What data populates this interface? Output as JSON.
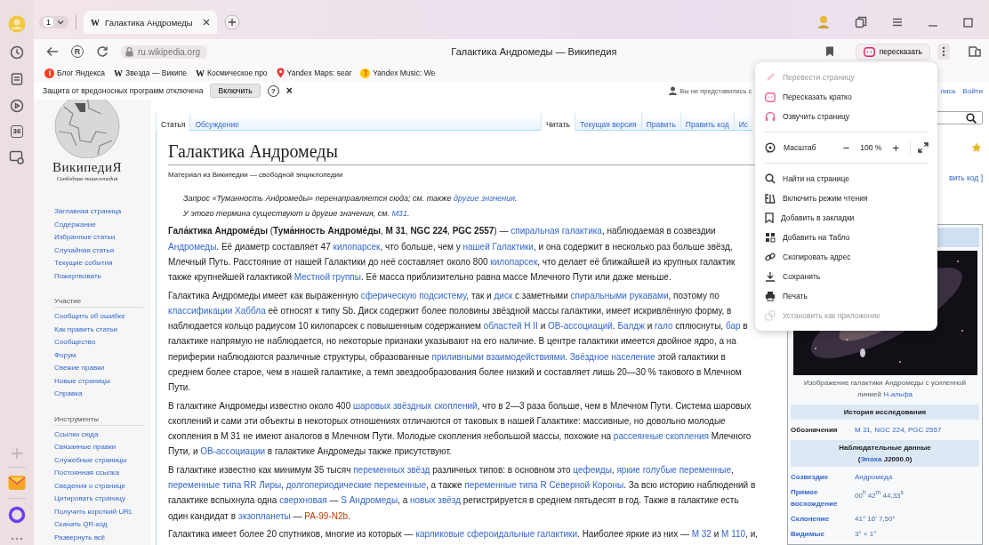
{
  "browser_sidebar": {
    "badge": "36"
  },
  "tab_bar": {
    "tab_count": "1",
    "tabs": [
      {
        "favicon": "W",
        "title": "Галактика Андромеды",
        "selected": true
      }
    ]
  },
  "address_bar": {
    "home_glyph": "R",
    "url": "ru.wikipedia.org",
    "page_title": "Галактика Андромеды — Википедия",
    "summarize_button": "пересказать"
  },
  "bookmarks": [
    {
      "kind": "yandex",
      "label": "Блог Яндекса"
    },
    {
      "kind": "wiki",
      "favicon": "W",
      "label": "Звезда — Википе"
    },
    {
      "kind": "wiki",
      "favicon": "W",
      "label": "Космическое про"
    },
    {
      "kind": "maps",
      "label": "Yandex Maps: sear"
    },
    {
      "kind": "music",
      "label": "Yandex Music: We"
    }
  ],
  "infobar": {
    "message": "Защита от вредоносных программ отключена",
    "button": "Включить",
    "help": "?",
    "close": "×"
  },
  "user_bar": {
    "notice": "Вы не представились с",
    "link": "лись",
    "login": "Войти"
  },
  "wiki_sidebar": {
    "logo_title": "ВикипедиЯ",
    "logo_subtitle": "Свободная энциклопедия",
    "groups": [
      {
        "links": [
          "Заглавная страница",
          "Содержание",
          "Избранные статьи",
          "Случайная статья",
          "Текущие события",
          "Пожертвовать"
        ]
      },
      {
        "heading": "Участие",
        "links": [
          "Сообщить об ошибке",
          "Как править статьи",
          "Сообщество",
          "Форум",
          "Свежие правки",
          "Новые страницы",
          "Справка"
        ]
      },
      {
        "heading": "Инструменты",
        "links": [
          "Ссылки сюда",
          "Связанные правки",
          "Служебные страницы",
          "Постоянная ссылка",
          "Сведения о странице",
          "Цитировать страницу",
          "Получить короткий URL",
          "Скачать QR-код",
          "Развернуть всё"
        ]
      }
    ]
  },
  "page_tabs": {
    "left": [
      {
        "label": "Статья",
        "selected": true
      },
      {
        "label": "Обсуждение",
        "selected": false
      }
    ],
    "right": [
      {
        "label": "Читать",
        "selected": true
      },
      {
        "label": "Текущая версия",
        "selected": false
      },
      {
        "label": "Править",
        "selected": false
      },
      {
        "label": "Править код",
        "selected": false
      },
      {
        "label": "Ис",
        "selected": false
      }
    ]
  },
  "article": {
    "title": "Галактика Андромеды",
    "subtitle": "Материал из Википедии — свободной энциклопедии",
    "hatnotes": [
      [
        {
          "kind": "text",
          "text": "Запрос «Туманность Андромеды» перенаправляется сюда; см. также "
        },
        {
          "kind": "link",
          "text": "другие значения"
        },
        {
          "kind": "text",
          "text": "."
        }
      ],
      [
        {
          "kind": "text",
          "text": "У этого термина существуют и другие значения, см. "
        },
        {
          "kind": "link",
          "text": "M31"
        },
        {
          "kind": "text",
          "text": "."
        }
      ]
    ],
    "paragraphs": [
      {
        "lines": [
          [
            {
              "kind": "text",
              "text": "**Гала́ктика Андроме́ды** (**Тума́нность Андроме́ды**, **M 31**, **NGC 224**, **PGC 2557**) — "
            },
            {
              "kind": "link",
              "text": "спиральная галактика"
            },
            {
              "kind": "text",
              "text": ", наблюдаемая в созвездии"
            }
          ],
          [
            {
              "kind": "link",
              "text": "Андромеды"
            },
            {
              "kind": "text",
              "text": ". Её диаметр составляет 47 "
            },
            {
              "kind": "link",
              "text": "килопарсек"
            },
            {
              "kind": "text",
              "text": ", что больше, чем у "
            },
            {
              "kind": "link",
              "text": "нашей Галактики"
            },
            {
              "kind": "text",
              "text": ", и она содержит в несколько раз больше звёзд,"
            }
          ],
          [
            {
              "kind": "text",
              "text": "Млечный Путь. Расстояние от нашей Галактики до неё составляет около 800 "
            },
            {
              "kind": "link",
              "text": "килопарсек"
            },
            {
              "kind": "text",
              "text": ", что делает её ближайшей из крупных галактик"
            }
          ],
          [
            {
              "kind": "text",
              "text": "также крупнейшей галактикой "
            },
            {
              "kind": "link",
              "text": "Местной группы"
            },
            {
              "kind": "text",
              "text": ". Её масса приблизительно равна массе Млечного Пути или даже меньше."
            }
          ]
        ]
      },
      {
        "lines": [
          [
            {
              "kind": "text",
              "text": "Галактика Андромеды имеет как выраженную "
            },
            {
              "kind": "link",
              "text": "сферическую подсистему"
            },
            {
              "kind": "text",
              "text": ", так и "
            },
            {
              "kind": "link",
              "text": "диск"
            },
            {
              "kind": "text",
              "text": " с заметными "
            },
            {
              "kind": "link",
              "text": "спиральными рукавами"
            },
            {
              "kind": "text",
              "text": ", поэтому по"
            }
          ],
          [
            {
              "kind": "link",
              "text": "классификации Хаббла"
            },
            {
              "kind": "text",
              "text": " её относят к типу Sb. Диск содержит более половины звёздной массы галактики, имеет искривлённую форму, в"
            }
          ],
          [
            {
              "kind": "text",
              "text": "наблюдается кольцо радиусом 10 килопарсек с повышенным содержанием "
            },
            {
              "kind": "link",
              "text": "областей H II"
            },
            {
              "kind": "text",
              "text": " и "
            },
            {
              "kind": "link",
              "text": "OB-ассоциаций"
            },
            {
              "kind": "text",
              "text": ". "
            },
            {
              "kind": "link",
              "text": "Балдж"
            },
            {
              "kind": "text",
              "text": " и "
            },
            {
              "kind": "link",
              "text": "гало"
            },
            {
              "kind": "text",
              "text": " сплюснуты, "
            },
            {
              "kind": "link",
              "text": "бар"
            },
            {
              "kind": "text",
              "text": " в"
            }
          ],
          [
            {
              "kind": "text",
              "text": "галактике напрямую не наблюдается, но некоторые признаки указывают на его наличие. В центре галактики имеется двойное ядро, а на"
            }
          ],
          [
            {
              "kind": "text",
              "text": "периферии наблюдаются различные структуры, образованные "
            },
            {
              "kind": "link",
              "text": "приливными взаимодействиями"
            },
            {
              "kind": "text",
              "text": ". "
            },
            {
              "kind": "link",
              "text": "Звёздное население"
            },
            {
              "kind": "text",
              "text": " этой галактики в"
            }
          ],
          [
            {
              "kind": "text",
              "text": "среднем более старое, чем в нашей галактике, а темп звездообразования более низкий и составляет лишь 20—30 % такового в Млечном"
            }
          ],
          [
            {
              "kind": "text",
              "text": "Пути."
            }
          ]
        ]
      },
      {
        "lines": [
          [
            {
              "kind": "text",
              "text": "В галактике Андромеды известно около 400 "
            },
            {
              "kind": "link",
              "text": "шаровых звёздных скоплений"
            },
            {
              "kind": "text",
              "text": ", что в 2—3 раза больше, чем в Млечном Пути. Система шаровых"
            }
          ],
          [
            {
              "kind": "text",
              "text": "скоплений и сами эти объекты в некоторых отношениях отличаются от таковых в нашей Галактике: массивные, но довольно молодые"
            }
          ],
          [
            {
              "kind": "text",
              "text": "скопления в M 31 не имеют аналогов в Млечном Пути. Молодые скопления небольшой массы, похожие на "
            },
            {
              "kind": "link",
              "text": "рассеянные скопления"
            },
            {
              "kind": "text",
              "text": " Млечного"
            }
          ],
          [
            {
              "kind": "text",
              "text": "Пути, и "
            },
            {
              "kind": "link",
              "text": "OB-ассоциации"
            },
            {
              "kind": "text",
              "text": " в галактике Андромеды также присутствуют."
            }
          ]
        ]
      },
      {
        "lines": [
          [
            {
              "kind": "text",
              "text": "В галактике известно как минимум 35 тысяч "
            },
            {
              "kind": "link",
              "text": "переменных звёзд"
            },
            {
              "kind": "text",
              "text": " различных типов: в основном это "
            },
            {
              "kind": "link",
              "text": "цефеиды"
            },
            {
              "kind": "text",
              "text": ", "
            },
            {
              "kind": "link",
              "text": "яркие голубые переменные"
            },
            {
              "kind": "text",
              "text": ","
            }
          ],
          [
            {
              "kind": "link",
              "text": "переменные типа RR Лиры"
            },
            {
              "kind": "text",
              "text": ", "
            },
            {
              "kind": "link",
              "text": "долгопериодические переменные"
            },
            {
              "kind": "text",
              "text": ", а также "
            },
            {
              "kind": "link",
              "text": "переменные типа R Северной Короны"
            },
            {
              "kind": "text",
              "text": ". За всю историю наблюдений в"
            }
          ],
          [
            {
              "kind": "text",
              "text": "галактике вспыхнула одна "
            },
            {
              "kind": "link",
              "text": "сверхновая"
            },
            {
              "kind": "text",
              "text": " — "
            },
            {
              "kind": "link",
              "text": "S Андромеды"
            },
            {
              "kind": "text",
              "text": ", а "
            },
            {
              "kind": "link",
              "text": "новых звёзд"
            },
            {
              "kind": "text",
              "text": " регистрируется в среднем пятьдесят в год. Также в галактике есть"
            }
          ],
          [
            {
              "kind": "text",
              "text": "один кандидат в "
            },
            {
              "kind": "link",
              "text": "экзопланеты"
            },
            {
              "kind": "text",
              "text": " — "
            },
            {
              "kind": "newlink",
              "text": "PA-99-N2b"
            },
            {
              "kind": "text",
              "text": "."
            }
          ]
        ]
      },
      {
        "lines": [
          [
            {
              "kind": "text",
              "text": "Галактика имеет более 20 спутников, многие из которых — "
            },
            {
              "kind": "link",
              "text": "карликовые сфероидальные галактики"
            },
            {
              "kind": "text",
              "text": ". Наиболее яркие из них — "
            },
            {
              "kind": "link",
              "text": "M 32"
            },
            {
              "kind": "text",
              "text": " и "
            },
            {
              "kind": "link",
              "text": "M 110"
            },
            {
              "kind": "text",
              "text": ", и,"
            }
          ]
        ]
      }
    ]
  },
  "side_column": {
    "edit_link": "вить код ]",
    "infobox": {
      "caption": [
        {
          "kind": "text",
          "text": "Изображение галактики Андромеды с усиленной линией "
        },
        {
          "kind": "link",
          "text": "H-альфа"
        }
      ],
      "rows": [
        {
          "kind": "header",
          "lines": [
            [
              {
                "kind": "text",
                "text": "История исследования"
              }
            ]
          ]
        },
        {
          "kind": "row",
          "label": "Обозначения",
          "label_link": false,
          "value": [
            {
              "kind": "link",
              "text": "M 31, NGC 224, PGC 2557"
            }
          ]
        },
        {
          "kind": "header",
          "lines": [
            [
              {
                "kind": "text",
                "text": "Наблюдательные данные"
              }
            ],
            [
              {
                "kind": "text",
                "text": "("
              },
              {
                "kind": "link",
                "text": "Эпоха"
              },
              {
                "kind": "text",
                "text": " J2000.0)"
              }
            ]
          ]
        },
        {
          "kind": "row",
          "label": "Созвездие",
          "label_link": true,
          "value": [
            {
              "kind": "link",
              "text": "Андромеда"
            }
          ]
        },
        {
          "kind": "row",
          "label": "Прямое восхождение",
          "label_link": true,
          "value": [
            {
              "kind": "text",
              "text": "00$^{h}$ 42$^{m}$ 44,33$^{s}$"
            }
          ]
        },
        {
          "kind": "row",
          "label": "Склонение",
          "label_link": true,
          "value": [
            {
              "kind": "text",
              "text": "41° 16′ 7,50″"
            }
          ]
        },
        {
          "kind": "row",
          "label": "Видимые",
          "label_link": true,
          "value": [
            {
              "kind": "text",
              "text": "3° × 1°"
            }
          ]
        }
      ]
    }
  },
  "menu": {
    "top_items": [
      {
        "label": "Перевести страницу",
        "disabled": true
      },
      {
        "label": "Пересказать кратко",
        "disabled": false
      },
      {
        "label": "Озвучить страницу",
        "disabled": false
      }
    ],
    "zoom": {
      "label": "Масштаб",
      "minus": "−",
      "value": "100 %",
      "plus": "+"
    },
    "items": [
      {
        "label": "Найти на странице",
        "disabled": false
      },
      {
        "label": "Включить режим чтения",
        "disabled": false
      },
      {
        "label": "Добавить в закладки",
        "disabled": false
      },
      {
        "label": "Добавить на Табло",
        "disabled": false
      },
      {
        "label": "Скопировать адрес",
        "disabled": false
      },
      {
        "label": "Сохранить",
        "disabled": false
      },
      {
        "label": "Печать",
        "disabled": false
      },
      {
        "label": "Установить как приложение",
        "disabled": true
      }
    ]
  }
}
